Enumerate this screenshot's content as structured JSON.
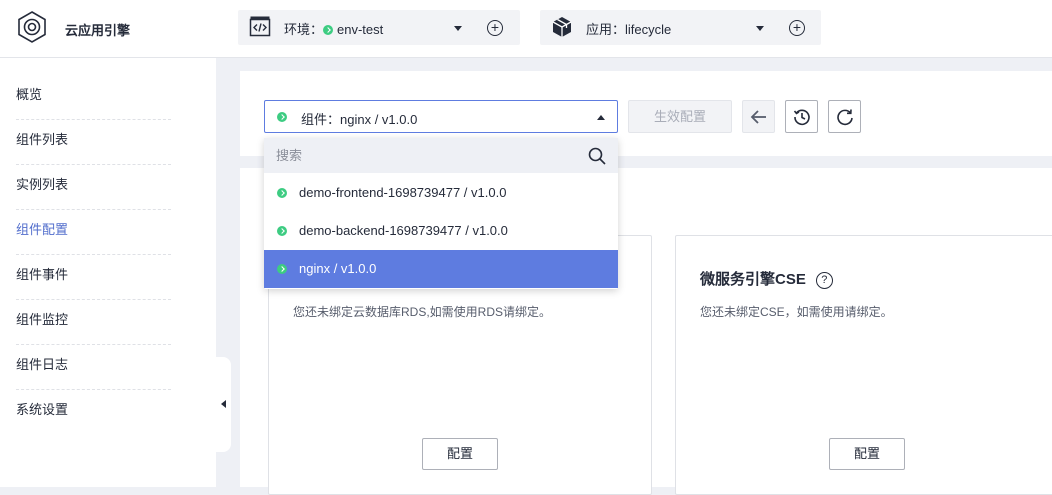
{
  "header": {
    "app_title": "云应用引擎",
    "env_selector": {
      "prefix": "环境：",
      "value": "env-test"
    },
    "app_selector": {
      "prefix": "应用：",
      "value": "lifecycle"
    }
  },
  "sidebar": {
    "items": [
      {
        "label": "概览"
      },
      {
        "label": "组件列表"
      },
      {
        "label": "实例列表"
      },
      {
        "label": "组件配置"
      },
      {
        "label": "组件事件"
      },
      {
        "label": "组件监控"
      },
      {
        "label": "组件日志"
      },
      {
        "label": "系统设置"
      }
    ],
    "active_index": 3
  },
  "toolbar": {
    "component_select": {
      "prefix": "组件：",
      "value": "nginx / v1.0.0"
    },
    "apply_label": "生效配置"
  },
  "dropdown": {
    "search_placeholder": "搜索",
    "options": [
      {
        "label": "demo-frontend-1698739477 / v1.0.0"
      },
      {
        "label": "demo-backend-1698739477 / v1.0.0"
      },
      {
        "label": "nginx / v1.0.0"
      }
    ],
    "selected_index": 2
  },
  "services": {
    "rds": {
      "desc": "您还未绑定云数据库RDS,如需使用RDS请绑定。",
      "button": "配置"
    },
    "cse": {
      "title": "微服务引擎CSE",
      "help": "?",
      "desc": "您还未绑定CSE，如需使用请绑定。",
      "button": "配置"
    }
  },
  "colors": {
    "accent": "#5e7ce0",
    "status_green": "#3dcc82"
  }
}
